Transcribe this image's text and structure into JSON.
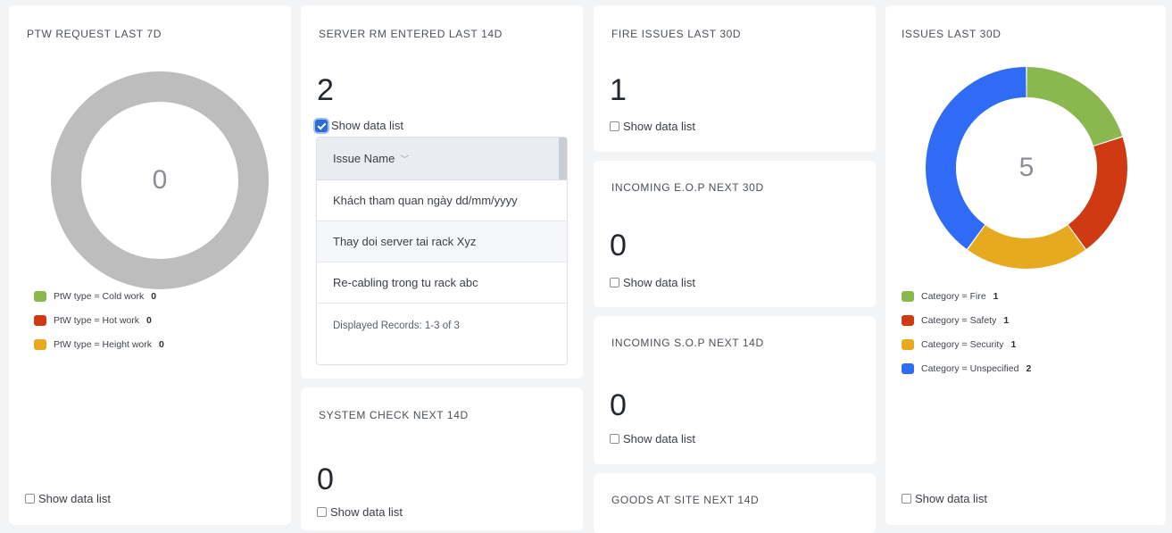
{
  "ptw": {
    "title": "PTW REQUEST LAST 7D",
    "center_value": "0",
    "legend": [
      {
        "label": "PtW type = Cold work",
        "count": "0",
        "color": "#8ab84e"
      },
      {
        "label": "PtW type = Hot work",
        "count": "0",
        "color": "#cf3a12"
      },
      {
        "label": "PtW type = Height work",
        "count": "0",
        "color": "#e6a91f"
      }
    ],
    "empty_ring_color": "#bdbdbd",
    "show_list_label": "Show data list",
    "show_list_checked": false
  },
  "server_rm": {
    "title": "SERVER RM ENTERED LAST 14D",
    "value": "2",
    "show_list_label": "Show data list",
    "show_list_checked": true,
    "table": {
      "column": "Issue Name",
      "rows": [
        "Khách tham quan ngày dd/mm/yyyy",
        "Thay doi server tai rack Xyz",
        "Re-cabling trong tu rack abc"
      ],
      "footer": "Displayed Records: 1-3 of 3"
    }
  },
  "system_check": {
    "title": "SYSTEM CHECK NEXT 14D",
    "value": "0",
    "show_list_label": "Show data list",
    "show_list_checked": false
  },
  "fire_issues": {
    "title": "FIRE ISSUES LAST 30D",
    "value": "1",
    "show_list_label": "Show data list",
    "show_list_checked": false
  },
  "incoming_eop": {
    "title": "INCOMING E.O.P NEXT 30D",
    "value": "0",
    "show_list_label": "Show data list",
    "show_list_checked": false
  },
  "incoming_sop": {
    "title": "INCOMING S.O.P NEXT 14D",
    "value": "0",
    "show_list_label": "Show data list",
    "show_list_checked": false
  },
  "goods_at_site": {
    "title": "GOODS AT SITE NEXT 14D"
  },
  "issues": {
    "title": "ISSUES LAST 30D",
    "center_value": "5",
    "show_list_label": "Show data list",
    "show_list_checked": false
  },
  "chart_data": [
    {
      "type": "pie",
      "title": "PTW REQUEST LAST 7D",
      "categories": [
        "PtW type = Cold work",
        "PtW type = Hot work",
        "PtW type = Height work"
      ],
      "values": [
        0,
        0,
        0
      ],
      "colors": [
        "#8ab84e",
        "#cf3a12",
        "#e6a91f"
      ],
      "total": 0,
      "legend": "bottom-left"
    },
    {
      "type": "pie",
      "title": "ISSUES LAST 30D",
      "categories": [
        "Category = Fire",
        "Category = Safety",
        "Category = Security",
        "Category = Unspecified"
      ],
      "values": [
        1,
        1,
        1,
        2
      ],
      "colors": [
        "#8ab84e",
        "#cf3a12",
        "#e6a91f",
        "#2f6bf5"
      ],
      "total": 5,
      "legend": "bottom-left"
    }
  ]
}
